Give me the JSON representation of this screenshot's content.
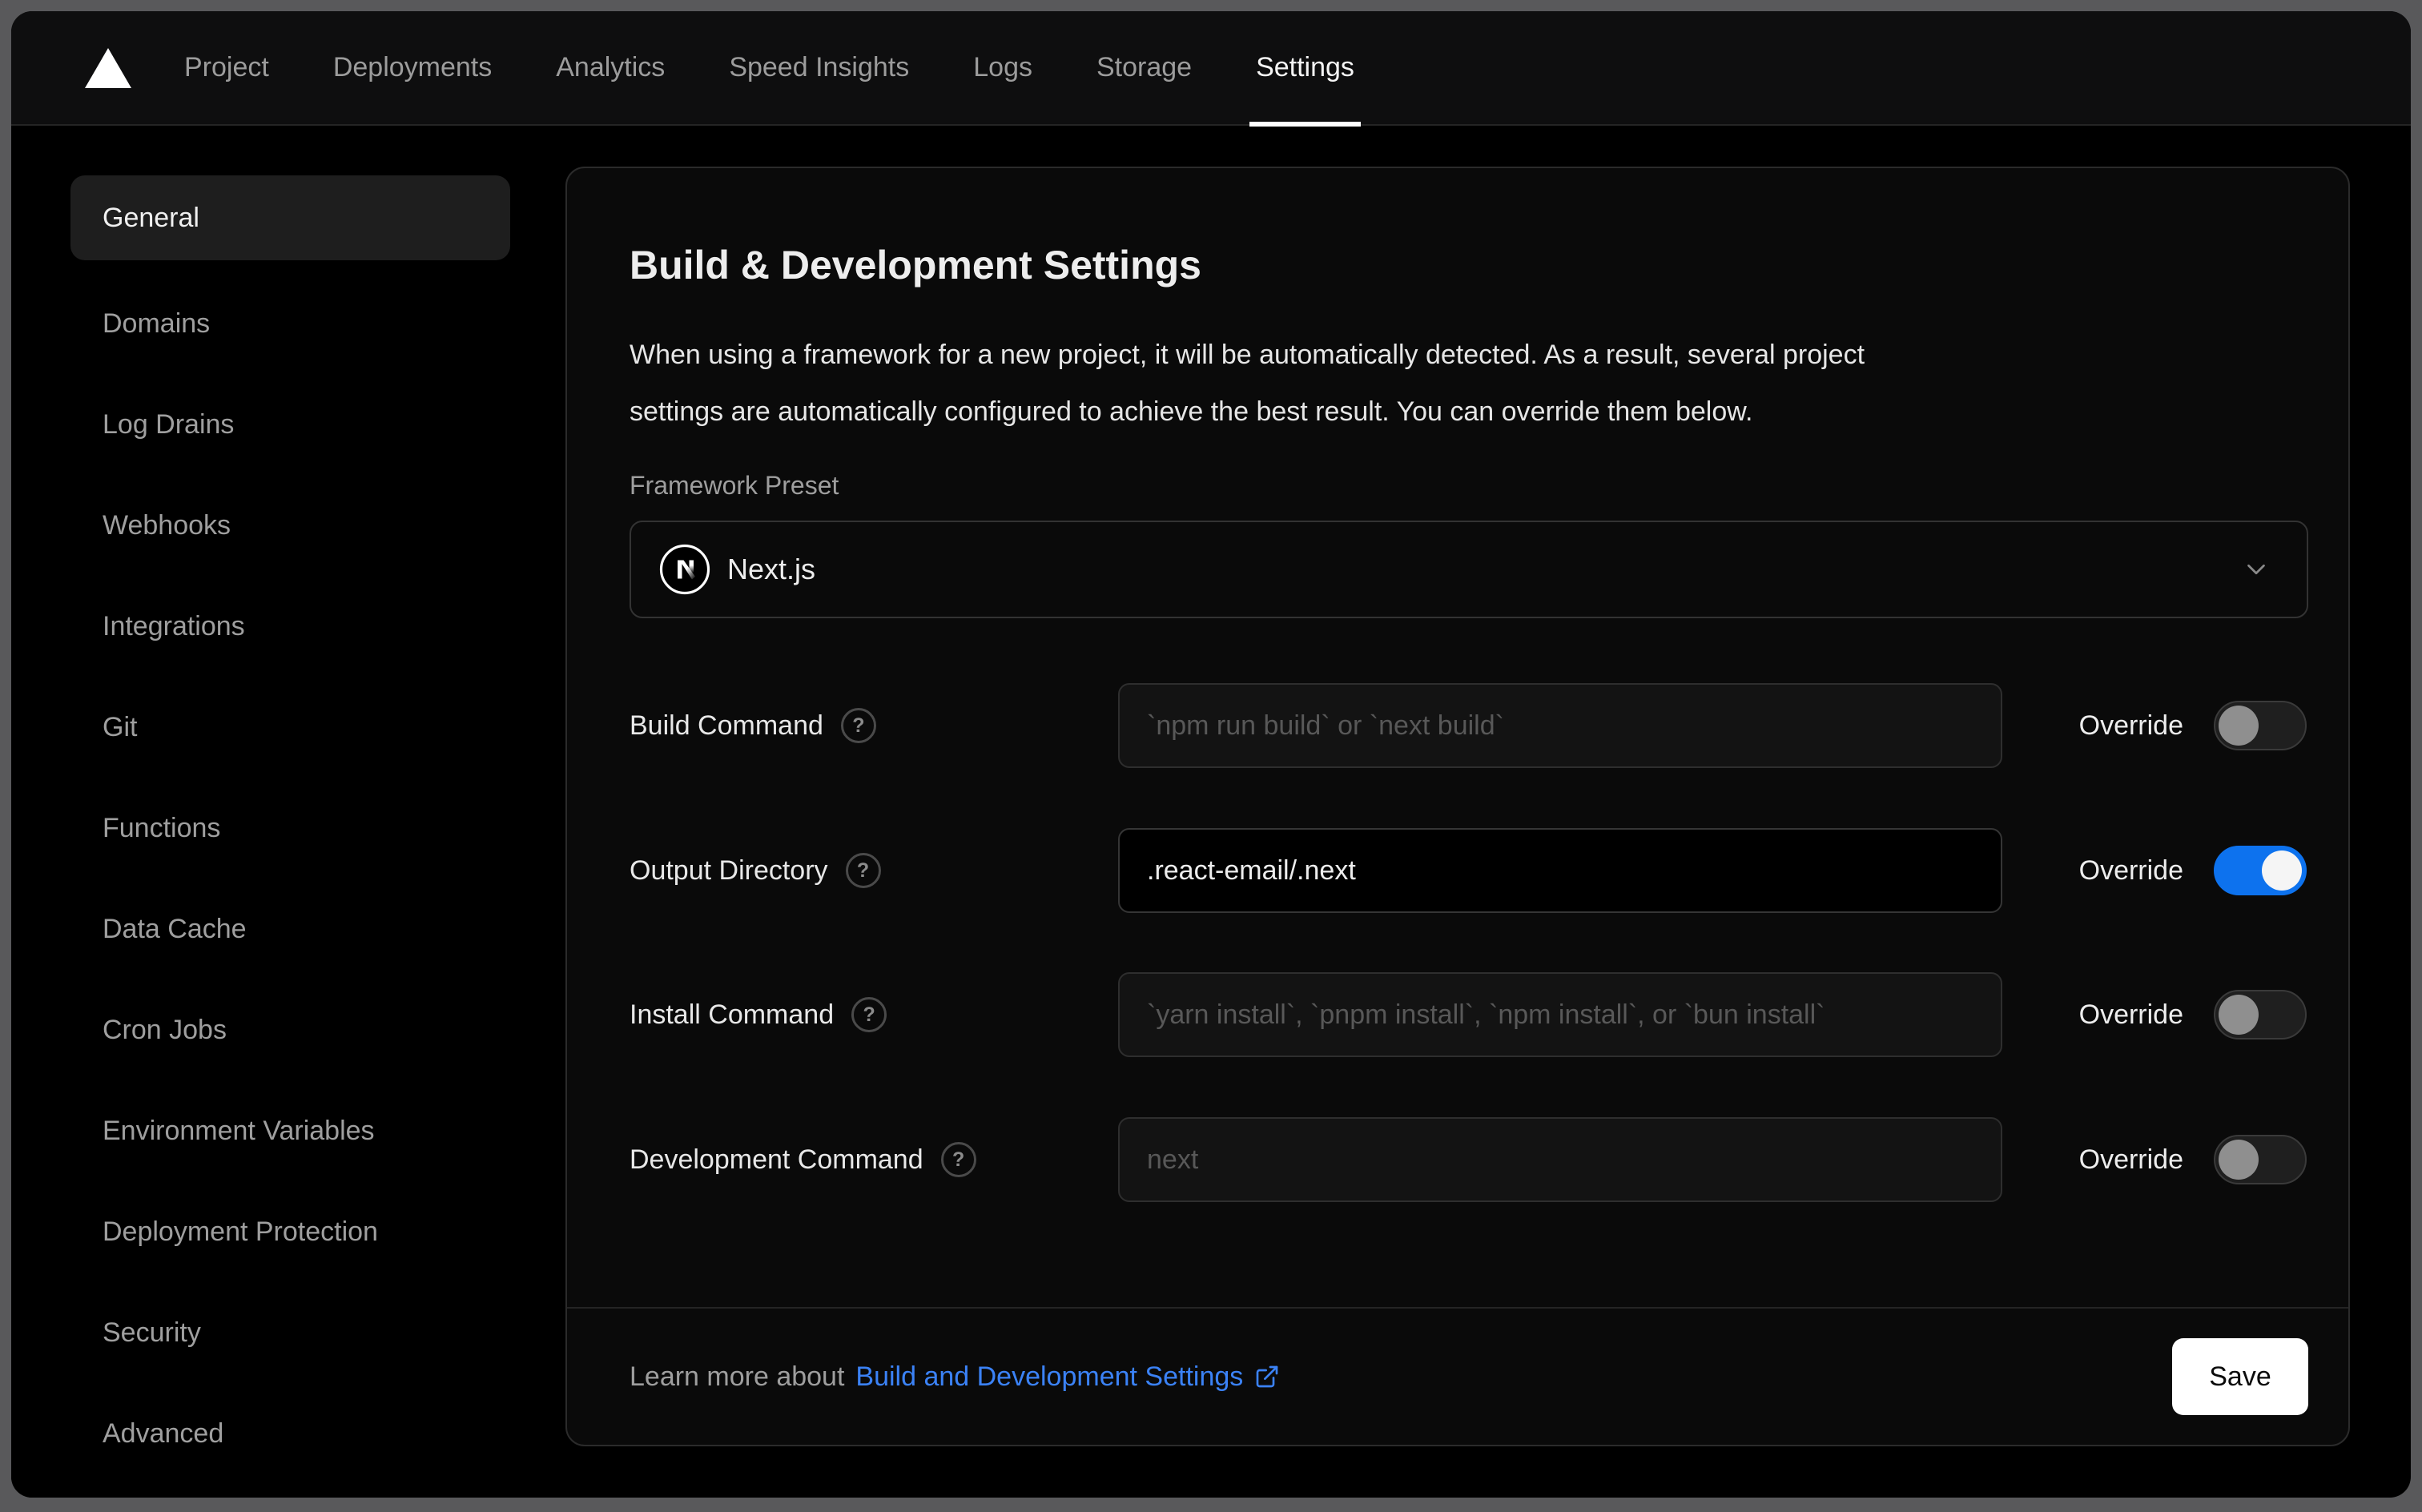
{
  "nav": {
    "logo": "vercel-triangle",
    "items": [
      "Project",
      "Deployments",
      "Analytics",
      "Speed Insights",
      "Logs",
      "Storage",
      "Settings"
    ],
    "active_item": "Settings"
  },
  "sidebar": {
    "active_item": "General",
    "items": [
      "General",
      "Domains",
      "Log Drains",
      "Webhooks",
      "Integrations",
      "Git",
      "Functions",
      "Data Cache",
      "Cron Jobs",
      "Environment Variables",
      "Deployment Protection",
      "Security",
      "Advanced"
    ]
  },
  "panel": {
    "title": "Build & Development Settings",
    "description_line1": "When using a framework for a new project, it will be automatically detected. As a result, several project",
    "description_line2": "settings are automatically configured to achieve the best result. You can override them below.",
    "framework": {
      "label": "Framework Preset",
      "value": "Next.js",
      "icon": "nextjs-logo"
    },
    "help_icon": "?",
    "override_label": "Override",
    "rows": [
      {
        "label": "Build Command",
        "placeholder": "`npm run build` or `next build`",
        "value": "",
        "override": false
      },
      {
        "label": "Output Directory",
        "placeholder": "",
        "value": ".react-email/.next",
        "override": true
      },
      {
        "label": "Install Command",
        "placeholder": "`yarn install`, `pnpm install`, `npm install`, or `bun install`",
        "value": "",
        "override": false
      },
      {
        "label": "Development Command",
        "placeholder": "next",
        "value": "",
        "override": false
      }
    ],
    "footer": {
      "text": "Learn more about",
      "link": "Build and Development Settings",
      "save": "Save"
    }
  },
  "colors": {
    "accent_blue": "#0d72ee",
    "link_blue": "#3b82f6",
    "save_button_bg": "#ffffff",
    "page_bg": "#000000",
    "card_bg": "#0a0a0a",
    "backdrop": "#59595b"
  }
}
